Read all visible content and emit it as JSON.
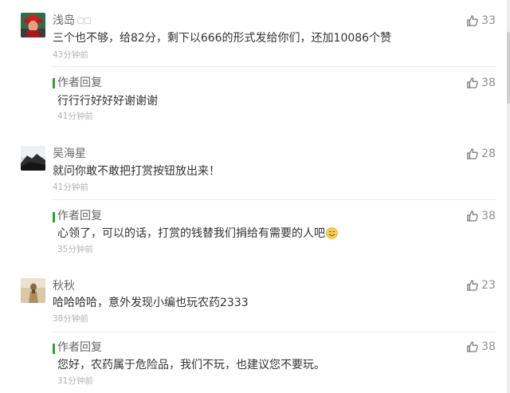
{
  "comments": [
    {
      "username": "浅岛",
      "name_suffix": "口口",
      "text": "三个也不够，给82分，剩下以666的形式发给你们，还加10086个赞",
      "time": "43分钟前",
      "likes": "33",
      "reply": {
        "label": "作者回复",
        "text": "行行行好好好谢谢谢",
        "time": "41分钟前",
        "likes": "38"
      }
    },
    {
      "username": "吴海星",
      "text": "就问你敢不敢把打赏按钮放出来！",
      "time": "41分钟前",
      "likes": "28",
      "reply": {
        "label": "作者回复",
        "text": "心领了，可以的话，打赏的钱替我们捐给有需要的人吧",
        "time": "35分钟前",
        "likes": "38"
      }
    },
    {
      "username": "秋秋",
      "text": "哈哈哈哈，意外发现小编也玩农药2333",
      "time": "38分钟前",
      "likes": "23",
      "reply": {
        "label": "作者回复",
        "text": "您好，农药属于危险品，我们不玩，也建议您不要玩。",
        "time": "31分钟前",
        "likes": "38"
      }
    }
  ],
  "colors": {
    "reply_accent": "#2ca42c",
    "text": "#333333",
    "muted": "#b2b2b2",
    "like": "#909090"
  },
  "icons": {
    "like": "thumbs-up-icon",
    "emoji": "smile-emoji-icon"
  }
}
